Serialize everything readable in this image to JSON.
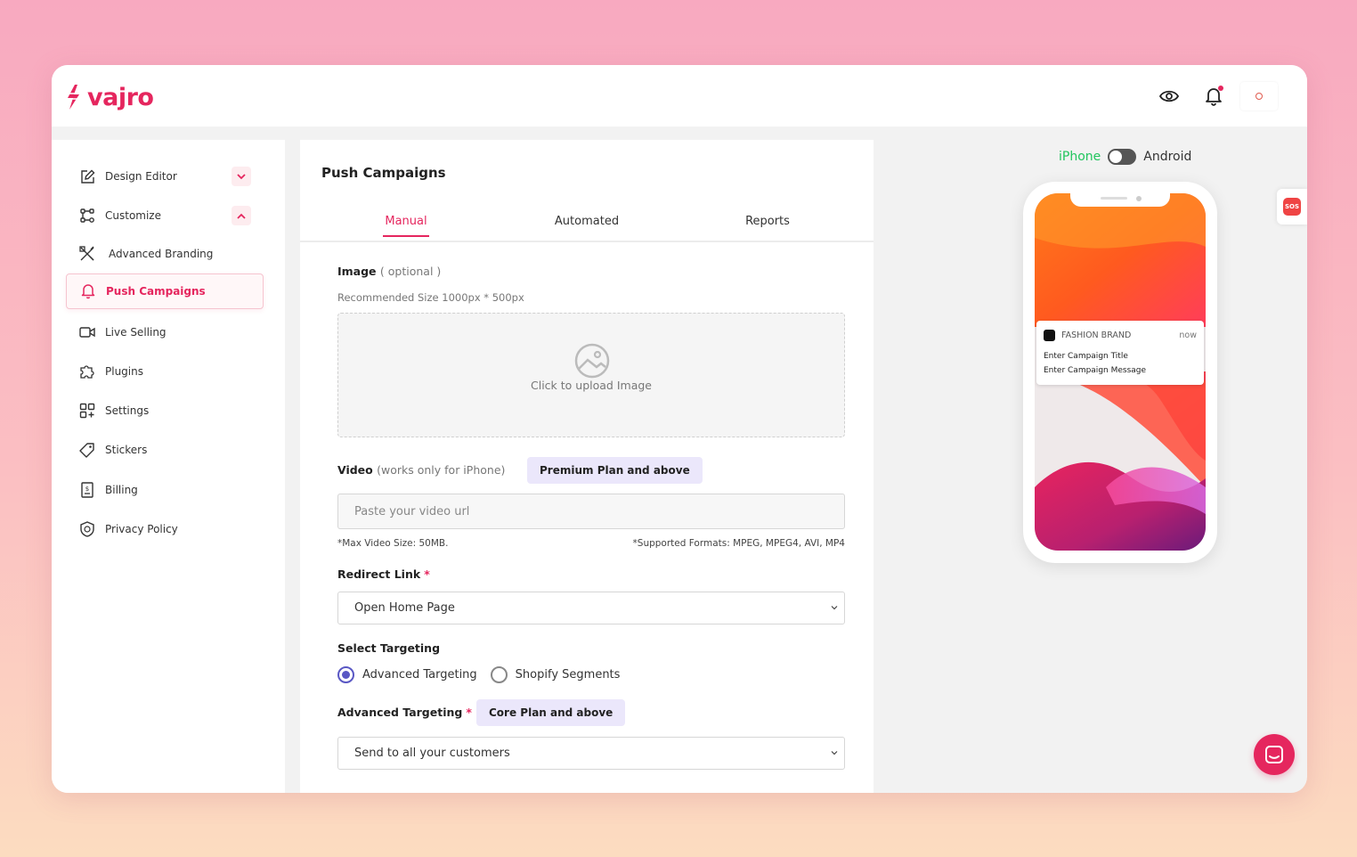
{
  "brand": {
    "name": "vajro",
    "color": "#e5265e"
  },
  "sidebar": {
    "items": [
      {
        "label": "Design Editor",
        "icon": "edit-icon"
      },
      {
        "label": "Customize",
        "icon": "customize-icon"
      },
      {
        "label": "Advanced Branding",
        "icon": "tools-icon"
      },
      {
        "label": "Push Campaigns",
        "icon": "bell-icon"
      },
      {
        "label": "Live Selling",
        "icon": "video-icon"
      },
      {
        "label": "Plugins",
        "icon": "puzzle-icon"
      },
      {
        "label": "Settings",
        "icon": "settings-grid-icon"
      },
      {
        "label": "Stickers",
        "icon": "tag-icon"
      },
      {
        "label": "Billing",
        "icon": "receipt-icon"
      },
      {
        "label": "Privacy Policy",
        "icon": "shield-icon"
      }
    ]
  },
  "main": {
    "title": "Push Campaigns",
    "tabs": [
      {
        "label": "Manual"
      },
      {
        "label": "Automated"
      },
      {
        "label": "Reports"
      }
    ],
    "image": {
      "label": "Image",
      "optional": "( optional )",
      "hint": "Recommended Size 1000px * 500px",
      "upload_text": "Click to upload Image"
    },
    "video": {
      "label": "Video",
      "note": "(works only for iPhone)",
      "badge": "Premium Plan and above",
      "placeholder": "Paste your video url",
      "max_size": "*Max Video Size: 50MB.",
      "formats": "*Supported Formats: MPEG, MPEG4, AVI, MP4"
    },
    "redirect": {
      "label": "Redirect Link",
      "required": "*",
      "value": "Open Home Page"
    },
    "targeting": {
      "label": "Select Targeting",
      "options": [
        {
          "label": "Advanced Targeting"
        },
        {
          "label": "Shopify Segments"
        }
      ]
    },
    "advanced_targeting": {
      "label": "Advanced Targeting",
      "required": "*",
      "badge": "Core Plan and above",
      "value": "Send to all your customers"
    }
  },
  "preview": {
    "toggle": {
      "left": "iPhone",
      "right": "Android"
    },
    "notification": {
      "app": "FASHION BRAND",
      "time": "now",
      "title": "Enter Campaign Title",
      "message": "Enter Campaign Message"
    }
  },
  "sos": "SOS"
}
